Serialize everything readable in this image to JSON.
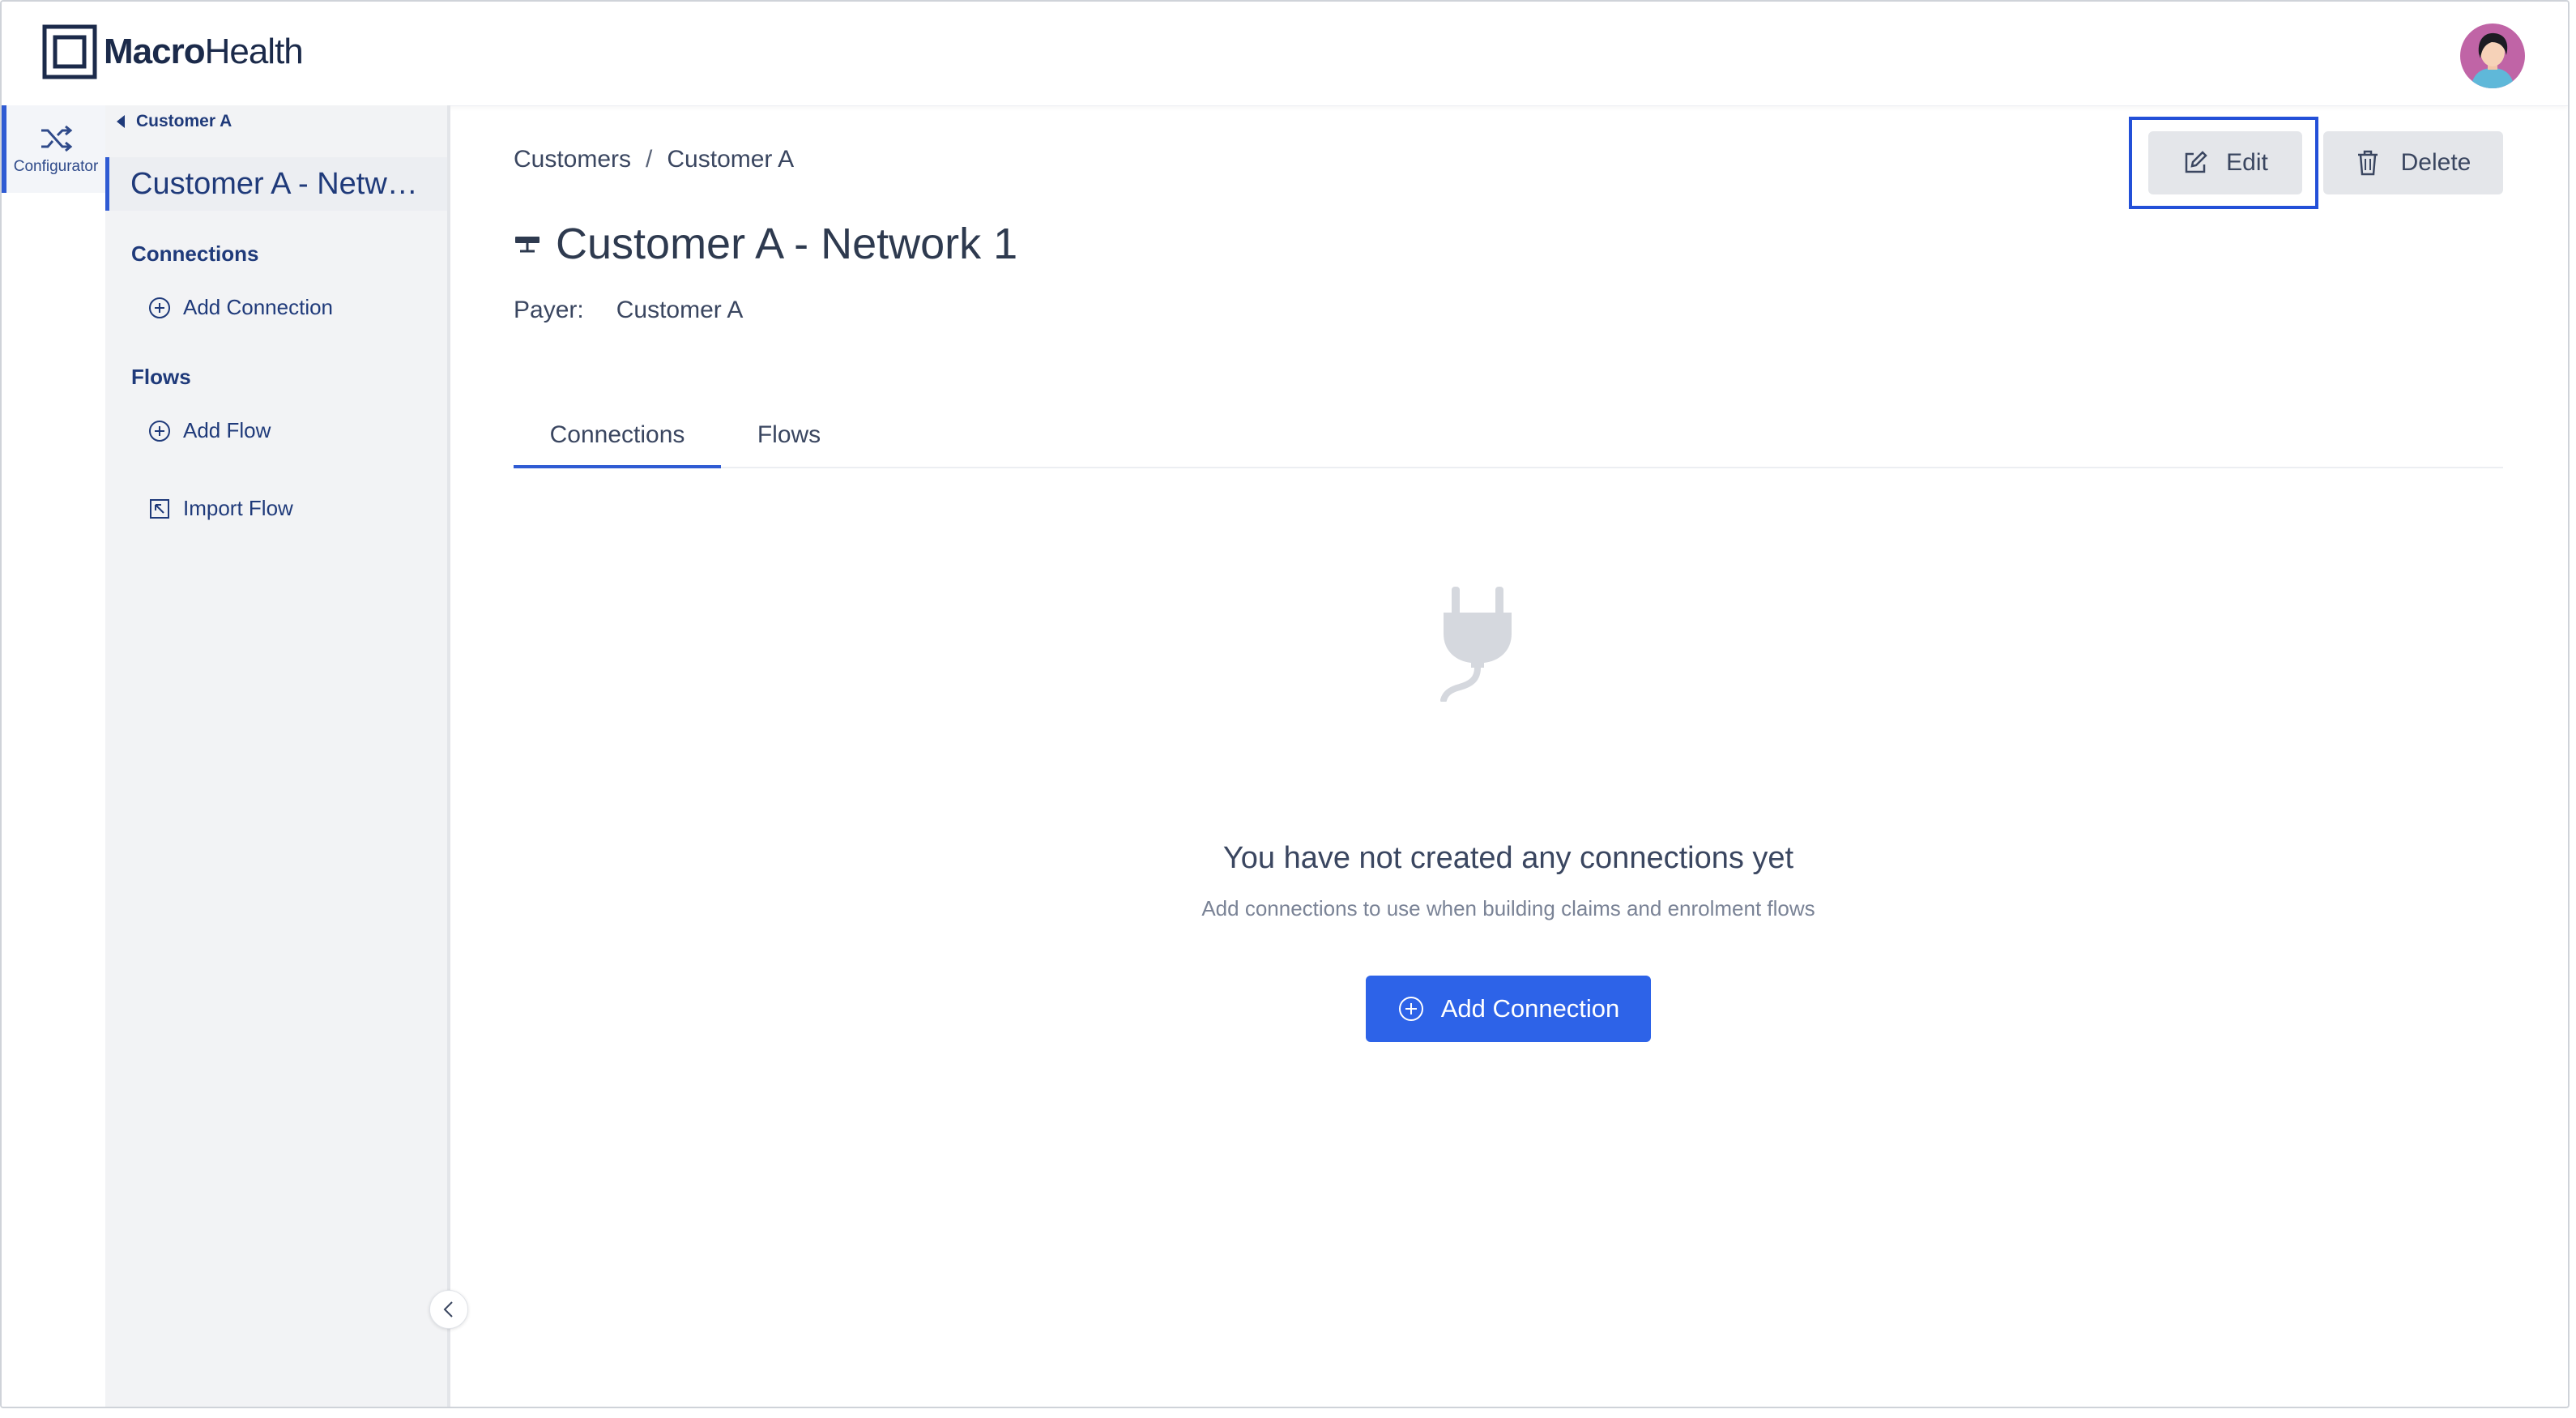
{
  "app": {
    "logo_text_bold": "Macro",
    "logo_text_regular": "Health"
  },
  "rail": {
    "configurator_label": "Configurator",
    "icon": "shuffle-icon"
  },
  "sidebar": {
    "back_label": "Customer A",
    "current_item": "Customer A - Network 1",
    "sections": [
      {
        "title": "Connections",
        "actions": [
          {
            "label": "Add Connection",
            "icon": "plus-circle-icon"
          }
        ]
      },
      {
        "title": "Flows",
        "actions": [
          {
            "label": "Add Flow",
            "icon": "plus-circle-icon"
          },
          {
            "label": "Import Flow",
            "icon": "import-icon"
          }
        ]
      }
    ]
  },
  "breadcrumb": [
    "Customers",
    "/",
    "Customer A"
  ],
  "page": {
    "title": "Customer A - Network 1",
    "payer_label": "Payer:",
    "payer_value": "Customer A"
  },
  "actions": {
    "edit_label": "Edit",
    "delete_label": "Delete"
  },
  "tabs": [
    {
      "label": "Connections",
      "active": true
    },
    {
      "label": "Flows",
      "active": false
    }
  ],
  "empty_state": {
    "icon": "plug-icon",
    "title": "You have not created any connections yet",
    "subtitle": "Add connections to use when building claims and enrolment flows",
    "button_label": "Add Connection"
  },
  "colors": {
    "primary": "#2d63e8",
    "nav_text": "#1f3a7a",
    "highlight": "#2350d8"
  }
}
